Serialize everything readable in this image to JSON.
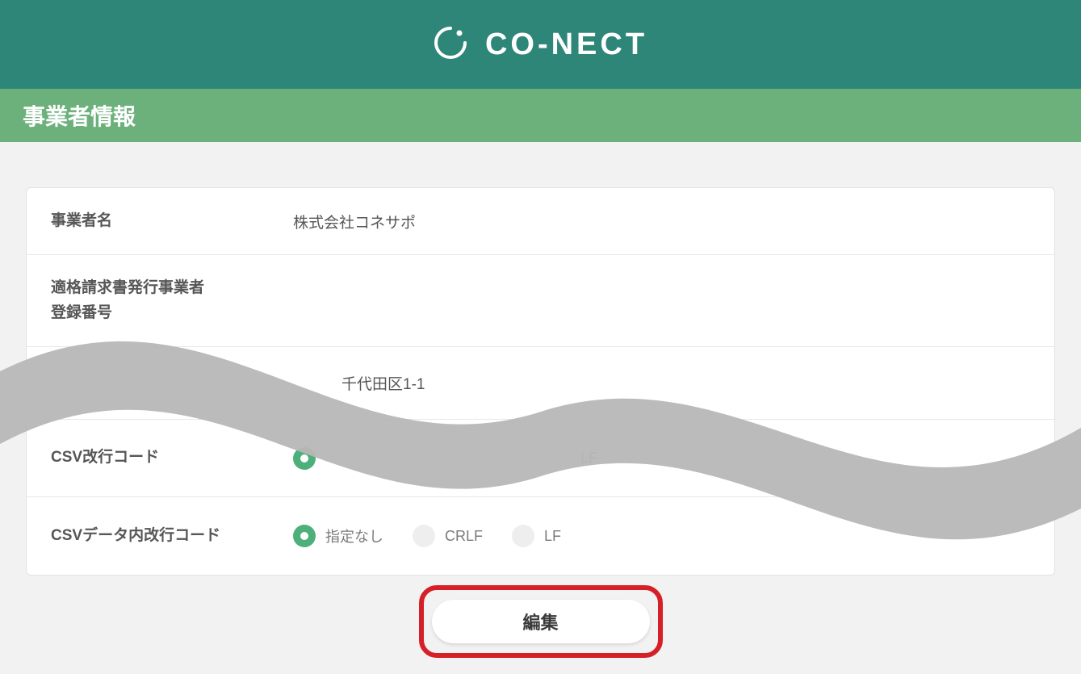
{
  "brand": {
    "name": "CO-NECT"
  },
  "page": {
    "title": "事業者情報"
  },
  "rows": {
    "company_name": {
      "label": "事業者名",
      "value": "株式会社コネサポ"
    },
    "invoice_number": {
      "label": "適格請求書発行事業者\n登録番号",
      "value": ""
    },
    "address_partial": {
      "value_fragment": "千代田区1-1"
    },
    "csv_newline": {
      "label": "CSV改行コード",
      "options": [
        {
          "label": "",
          "selected": true
        },
        {
          "label": "LF",
          "selected": false
        }
      ]
    },
    "csv_data_newline": {
      "label": "CSVデータ内改行コード",
      "options": [
        {
          "label": "指定なし",
          "selected": true
        },
        {
          "label": "CRLF",
          "selected": false
        },
        {
          "label": "LF",
          "selected": false
        }
      ]
    }
  },
  "buttons": {
    "edit": "編集"
  }
}
